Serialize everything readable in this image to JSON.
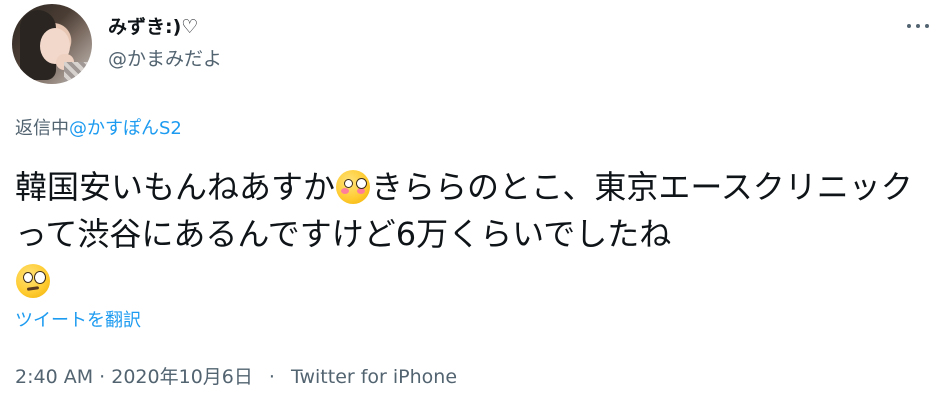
{
  "user": {
    "display_name": "みずき:)♡",
    "handle": "@かまみだよ"
  },
  "reply": {
    "prefix": "返信中",
    "to": "@かすぽんS2"
  },
  "tweet": {
    "part1": "韓国安いもんねあすか",
    "emoji1": "flushed-face",
    "part2": "きららのとこ、東京エースクリニックって渋谷にあるんですけど6万くらいでしたね",
    "emoji2": "face-with-rolling-eyes"
  },
  "translate_label": "ツイートを翻訳",
  "meta": {
    "time": "2:40 AM",
    "dot": "·",
    "date": "2020年10月6日",
    "sep": "·",
    "source": "Twitter for iPhone"
  },
  "icons": {
    "more": "more-horizontal-icon"
  },
  "colors": {
    "link": "#1d9bf0",
    "secondary": "#536471",
    "text": "#0f1419"
  }
}
